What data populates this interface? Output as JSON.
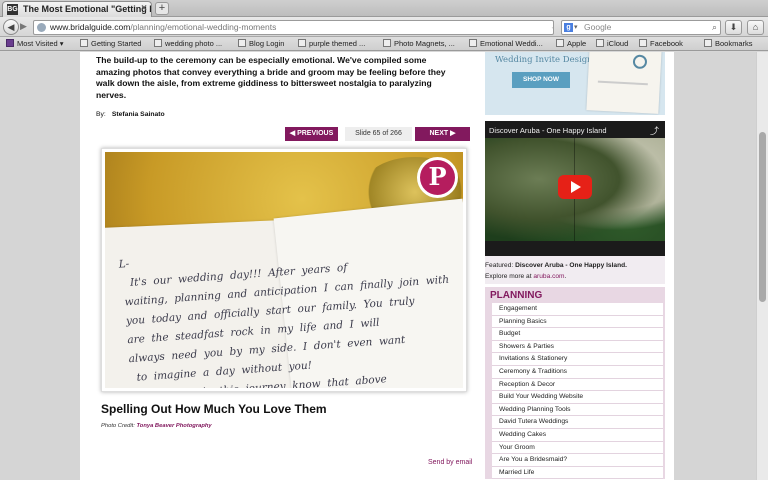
{
  "browser": {
    "tab_title": "The Most Emotional \"Getting Re...",
    "url_host": "www.bridalguide.com",
    "url_path": "/planning/emotional-wedding-moments",
    "search_placeholder": "Google",
    "bookmarks": [
      "Most Visited",
      "Getting Started",
      "wedding photo ...",
      "Blog Login",
      "purple themed ...",
      "Photo Magnets, ...",
      "Emotional Weddi...",
      "Apple",
      "iCloud",
      "Facebook",
      "Bookmarks"
    ]
  },
  "article": {
    "intro": "The build-up to the ceremony can be especially emotional. We've compiled some amazing photos that convey everything a bride and groom may be feeling before they walk down the aisle, from extreme giddiness to bittersweet nostalgia to paralyzing nerves.",
    "by_label": "By:",
    "author": "Stefania Sainato",
    "prev_label": "◀ PREVIOUS",
    "slide_counter": "Slide 65 of 266",
    "next_label": "NEXT ▶",
    "photo_note": "L-\n   It's  our  wedding  day!!!  After  years  of\n waiting,  planning  and  anticipation  I  can  finally  join  with\n you  today  and  officially  start  our  family.  You  truly\n are  the  steadfast  rock  in  my  life  and  I  will\n always  need  you  by  my  side.  I  don't  even  want\n   to  imagine  a  day  without  you!\n    As  we  begin  this  journey  know  that  above",
    "caption_title": "Spelling Out How Much You Love Them",
    "credit_label": "Photo Credit:",
    "credit_name": "Tonya Beaver Photography",
    "send_email": "Send by email"
  },
  "sidebar": {
    "ad_title": "Wedding Invite Designs",
    "ad_button": "SHOP NOW",
    "video_title": "Discover Aruba - One Happy Island",
    "featured_label": "Featured:",
    "featured_title": "Discover Aruba - One Happy Island.",
    "explore_text": "Explore more at",
    "explore_link": "aruba.com",
    "planning_heading": "PLANNING",
    "planning_items": [
      "Engagement",
      "Planning Basics",
      "Budget",
      "Showers & Parties",
      "Invitations & Stationery",
      "Ceremony & Traditions",
      "Reception & Decor",
      "Build Your Wedding Website",
      "Wedding Planning Tools",
      "David Tutera Weddings",
      "Wedding Cakes",
      "Your Groom",
      "Are You a Bridesmaid?",
      "Married Life"
    ]
  },
  "colors": {
    "brand": "#82195e",
    "pinterest": "#b51d5e",
    "youtube": "#e62117"
  },
  "icons": [
    "back-icon",
    "forward-icon",
    "star-icon",
    "reload-icon",
    "search-icon",
    "download-icon",
    "home-icon",
    "share-icon",
    "play-icon",
    "pinterest-icon"
  ]
}
